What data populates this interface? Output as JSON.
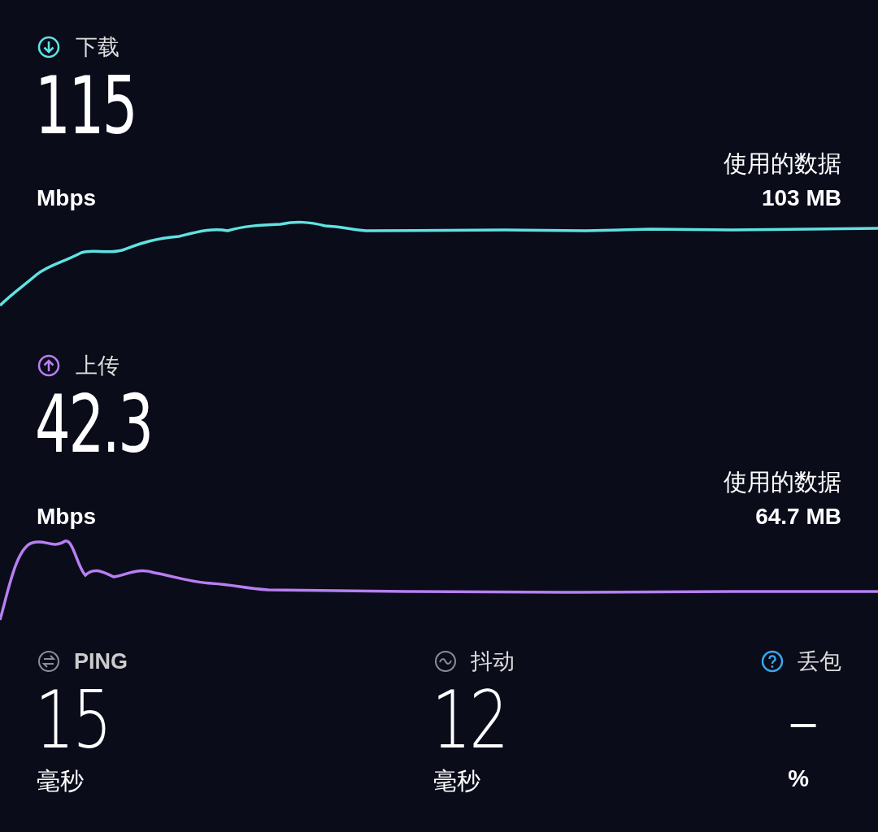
{
  "tests": [
    {
      "kind": "download",
      "label": "下载",
      "value": "115",
      "unit": "Mbps",
      "data_label": "使用的数据",
      "data_value": "103 MB",
      "color": "#5fe3e1"
    },
    {
      "kind": "upload",
      "label": "上传",
      "value": "42.3",
      "unit": "Mbps",
      "data_label": "使用的数据",
      "data_value": "64.7 MB",
      "color": "#b87ef2"
    }
  ],
  "metrics": [
    {
      "kind": "ping",
      "label": "PING",
      "value": "15",
      "unit": "毫秒"
    },
    {
      "kind": "jitter",
      "label": "抖动",
      "value": "12",
      "unit": "毫秒"
    },
    {
      "kind": "loss",
      "label": "丢包",
      "value": "–",
      "unit": "%"
    }
  ]
}
